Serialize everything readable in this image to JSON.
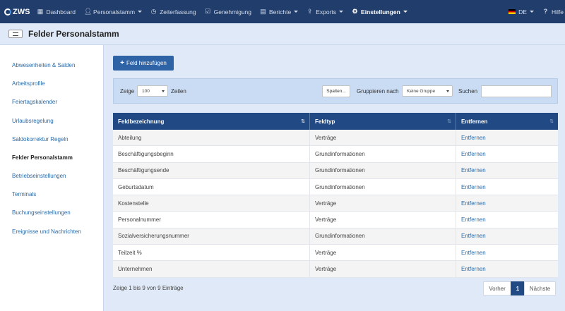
{
  "navbar": {
    "brand": "ZWS",
    "items": [
      {
        "label": "Dashboard",
        "icon": "grid-icon"
      },
      {
        "label": "Personalstamm",
        "icon": "user-icon",
        "caret": true
      },
      {
        "label": "Zeiterfassung",
        "icon": "clock-icon"
      },
      {
        "label": "Genehmigung",
        "icon": "check-icon"
      },
      {
        "label": "Berichte",
        "icon": "document-icon",
        "caret": true
      },
      {
        "label": "Exports",
        "icon": "export-icon",
        "caret": true
      },
      {
        "label": "Einstellungen",
        "icon": "gear-icon",
        "caret": true,
        "active": true
      }
    ],
    "language": "DE",
    "help": "Hilfe"
  },
  "page": {
    "title": "Felder Personalstamm"
  },
  "sidebar": {
    "items": [
      {
        "label": "Abwesenheiten & Salden"
      },
      {
        "label": "Arbeitsprofile"
      },
      {
        "label": "Feiertagskalender"
      },
      {
        "label": "Urlaubsregelung"
      },
      {
        "label": "Saldokorrektur Regeln"
      },
      {
        "label": "Felder Personalstamm",
        "active": true
      },
      {
        "label": "Betriebseinstellungen"
      },
      {
        "label": "Terminals"
      },
      {
        "label": "Buchungseinstellungen"
      },
      {
        "label": "Ereignisse und Nachrichten"
      }
    ]
  },
  "toolbar": {
    "add_label": "Feld hinzufügen"
  },
  "filter": {
    "show_label": "Zeige",
    "page_size": "100",
    "rows_label": "Zeilen",
    "columns_button": "Spalten...",
    "group_label": "Gruppieren nach",
    "group_value": "Keine Gruppe",
    "search_label": "Suchen",
    "search_value": ""
  },
  "table": {
    "headers": [
      "Feldbezeichnung",
      "Feldtyp",
      "Entfernen"
    ],
    "rows": [
      {
        "name": "Abteilung",
        "type": "Verträge",
        "action": "Entfernen"
      },
      {
        "name": "Beschäftigungsbeginn",
        "type": "Grundinformationen",
        "action": "Entfernen"
      },
      {
        "name": "Beschäftigungsende",
        "type": "Grundinformationen",
        "action": "Entfernen"
      },
      {
        "name": "Geburtsdatum",
        "type": "Grundinformationen",
        "action": "Entfernen"
      },
      {
        "name": "Kostenstelle",
        "type": "Verträge",
        "action": "Entfernen"
      },
      {
        "name": "Personalnummer",
        "type": "Verträge",
        "action": "Entfernen"
      },
      {
        "name": "Sozialversicherungsnummer",
        "type": "Grundinformationen",
        "action": "Entfernen"
      },
      {
        "name": "Teilzeit %",
        "type": "Verträge",
        "action": "Entfernen"
      },
      {
        "name": "Unternehmen",
        "type": "Verträge",
        "action": "Entfernen"
      }
    ]
  },
  "footer": {
    "info": "Zeige 1 bis 9 von 9 Einträge",
    "prev": "Vorher",
    "page": "1",
    "next": "Nächste"
  },
  "colors": {
    "navbar": "#213d6b",
    "header": "#214a84",
    "link": "#2a6aa8",
    "accent": "#2e63a6"
  }
}
